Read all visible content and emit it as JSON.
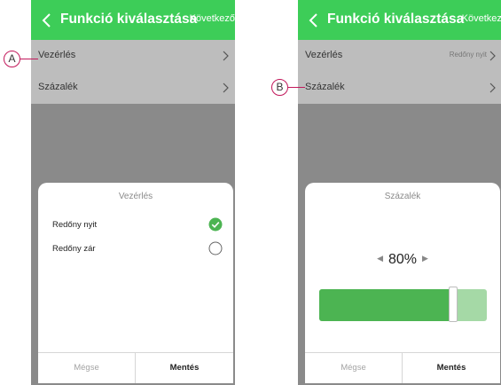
{
  "colors": {
    "brand": "#3dcd58",
    "slider_fill": "#4cb452",
    "slider_track": "#a5d9a6",
    "callout": "#c2185b"
  },
  "screen_a": {
    "header": {
      "title": "Funkció kiválasztása",
      "next": "Következő"
    },
    "menu": [
      {
        "label": "Vezérlés",
        "value": ""
      },
      {
        "label": "Százalék",
        "value": ""
      }
    ],
    "sheet": {
      "title": "Vezérlés",
      "options": [
        {
          "label": "Redőny nyit",
          "selected": true
        },
        {
          "label": "Redőny zár",
          "selected": false
        }
      ],
      "cancel": "Mégse",
      "save": "Mentés"
    },
    "callout": "A"
  },
  "screen_b": {
    "header": {
      "title": "Funkció kiválasztása",
      "next": "Következő"
    },
    "menu": [
      {
        "label": "Vezérlés",
        "value": "Redőny nyit"
      },
      {
        "label": "Százalék",
        "value": ""
      }
    ],
    "sheet": {
      "title": "Százalék",
      "percent_text": "80%",
      "percent_value": 80,
      "cancel": "Mégse",
      "save": "Mentés"
    },
    "callout": "B"
  }
}
